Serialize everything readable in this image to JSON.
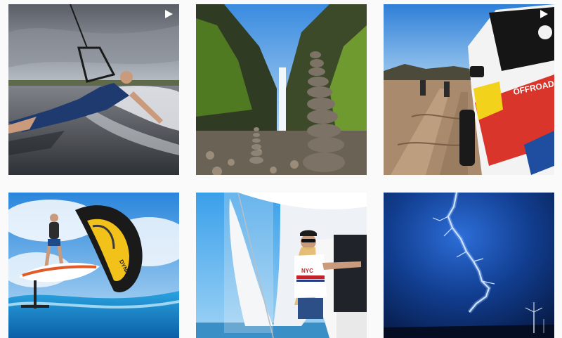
{
  "grid": {
    "posts": [
      {
        "id": "post-waterski",
        "subject": "waterskiing",
        "is_video": true,
        "overlay_text": ""
      },
      {
        "id": "post-waterfall",
        "subject": "waterfall-stone-cairns",
        "is_video": false,
        "overlay_text": ""
      },
      {
        "id": "post-offroad",
        "subject": "offroad-buggy",
        "is_video": true,
        "overlay_text": "OFFROAD"
      },
      {
        "id": "post-wingfoil",
        "subject": "wing-foiling",
        "is_video": false,
        "overlay_text": "DYNAMIX"
      },
      {
        "id": "post-sailing",
        "subject": "sailing",
        "is_video": false,
        "overlay_text": "NYC"
      },
      {
        "id": "post-lightning",
        "subject": "lightning-storm",
        "is_video": false,
        "overlay_text": ""
      }
    ]
  },
  "icons": {
    "video": "play-icon"
  },
  "colors": {
    "background": "#fafafa",
    "sky_blue": "#2f86d8",
    "offroad_red": "#d9352b",
    "wing_yellow": "#f2c21a"
  }
}
